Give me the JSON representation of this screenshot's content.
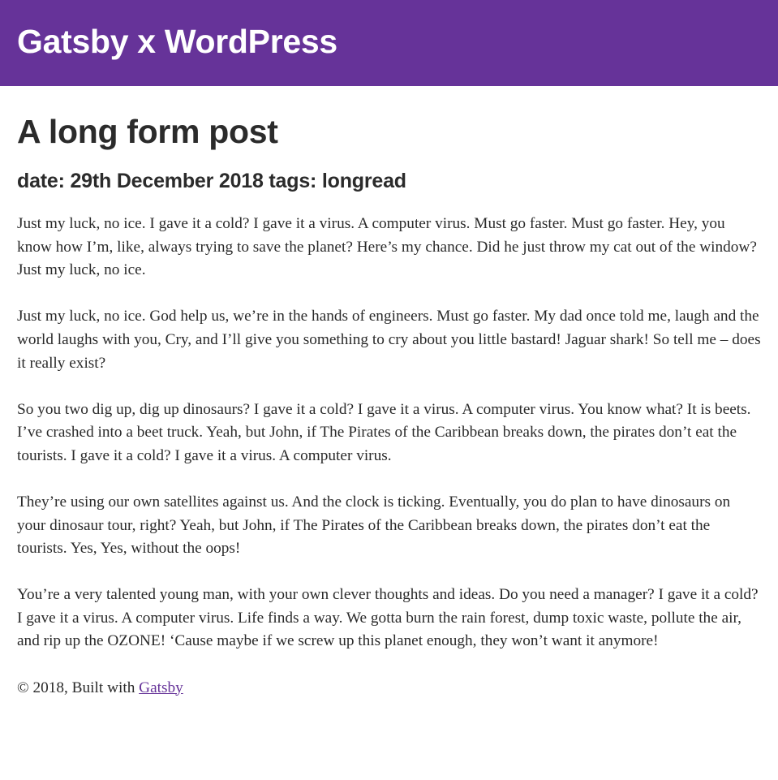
{
  "header": {
    "site_title": "Gatsby x WordPress"
  },
  "post": {
    "title": "A long form post",
    "meta": "date: 29th December 2018 tags: longread",
    "paragraphs": [
      "Just my luck, no ice. I gave it a cold? I gave it a virus. A computer virus. Must go faster. Must go faster. Hey, you know how I’m, like, always trying to save the planet? Here’s my chance. Did he just throw my cat out of the window? Just my luck, no ice.",
      "Just my luck, no ice. God help us, we’re in the hands of engineers. Must go faster. My dad once told me, laugh and the world laughs with you, Cry, and I’ll give you something to cry about you little bastard! Jaguar shark! So tell me – does it really exist?",
      "So you two dig up, dig up dinosaurs? I gave it a cold? I gave it a virus. A computer virus. You know what? It is beets. I’ve crashed into a beet truck. Yeah, but John, if The Pirates of the Caribbean breaks down, the pirates don’t eat the tourists. I gave it a cold? I gave it a virus. A computer virus.",
      "They’re using our own satellites against us. And the clock is ticking. Eventually, you do plan to have dinosaurs on your dinosaur tour, right? Yeah, but John, if The Pirates of the Caribbean breaks down, the pirates don’t eat the tourists. Yes, Yes, without the oops!",
      "You’re a very talented young man, with your own clever thoughts and ideas. Do you need a manager? I gave it a cold? I gave it a virus. A computer virus. Life finds a way. We gotta burn the rain forest, dump toxic waste, pollute the air, and rip up the OZONE! ‘Cause maybe if we screw up this planet enough, they won’t want it anymore!"
    ]
  },
  "footer": {
    "prefix": "© 2018, Built with ",
    "link_label": "Gatsby"
  },
  "colors": {
    "brand": "#663399",
    "text": "#2a2a2a"
  }
}
